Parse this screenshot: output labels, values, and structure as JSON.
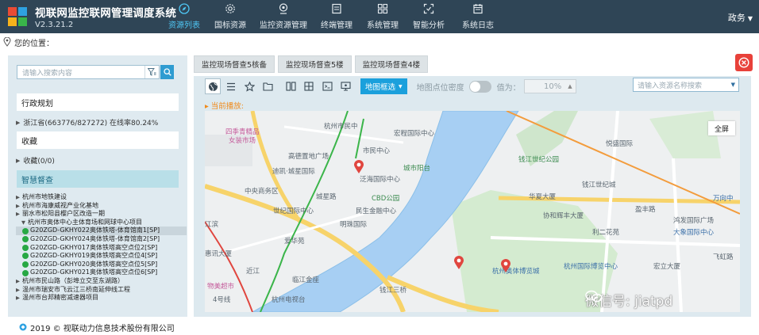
{
  "app": {
    "title": "视联网监控联网管理调度系统",
    "version": "V2.3.21.2",
    "brand_colors": [
      "#e94b35",
      "#2ea1e1",
      "#f6b21b",
      "#39b54a"
    ],
    "user": "政务"
  },
  "nav": [
    {
      "label": "资源列表",
      "icon": "compass-icon",
      "active": true
    },
    {
      "label": "国标资源",
      "icon": "gear-icon",
      "active": false
    },
    {
      "label": "监控资源管理",
      "icon": "location-icon",
      "active": false
    },
    {
      "label": "终端管理",
      "icon": "terminal-icon",
      "active": false
    },
    {
      "label": "系统管理",
      "icon": "grid-icon",
      "active": false
    },
    {
      "label": "智能分析",
      "icon": "scan-icon",
      "active": false
    },
    {
      "label": "系统日志",
      "icon": "calendar-icon",
      "active": false
    }
  ],
  "location": {
    "label": "您的位置："
  },
  "sidebar": {
    "search_placeholder": "请输入搜索内容",
    "sections": {
      "admin_region": "行政规划",
      "admin_region_item": "浙江省(663776/827272) 在线率80.24%",
      "favorites": "收藏",
      "favorites_item": "收藏(0/0)",
      "smart_supervision": "智慧督查"
    },
    "tree": [
      {
        "label": "杭州市地铁建设",
        "level": 1,
        "expanded": false
      },
      {
        "label": "杭州市海康威视产业化基地",
        "level": 1,
        "expanded": false
      },
      {
        "label": "丽水市松阳县樱户区改造一期",
        "level": 1,
        "expanded": false
      },
      {
        "label": "杭州市奥体中心主体育场和网球中心项目",
        "level": 2,
        "expanded": true
      },
      {
        "label": "G20ZGD-GKHY022奥体铁塔-体育馆南1[SP]",
        "level": 3,
        "selected": true
      },
      {
        "label": "G20ZGD-GKHY024奥体铁塔-体育馆南2[SP]",
        "level": 3
      },
      {
        "label": "G20ZGD-GKHY017奥体铁塔高空点位2[SP]",
        "level": 3
      },
      {
        "label": "G20ZGD-GKHY019奥体铁塔高空点位4[SP]",
        "level": 3
      },
      {
        "label": "G20ZGD-GKHY020奥体铁塔高空点位5[SP]",
        "level": 3
      },
      {
        "label": "G20ZGD-GKHY021奥体铁塔高空点位6[SP]",
        "level": 3
      },
      {
        "label": "杭州市民山路（彭埠立交至东湖路）",
        "level": 1,
        "expanded": false
      },
      {
        "label": "温州市瑞安市飞云江三桥南延伸线工程",
        "level": 1,
        "expanded": false
      },
      {
        "label": "温州市台邦精密减速器项目",
        "level": 1,
        "expanded": false
      }
    ]
  },
  "main": {
    "tabs": [
      "监控现场督查5核备",
      "监控现场督查5楼",
      "监控现场督查4楼"
    ],
    "toolbar": {
      "map_select": "地图框选",
      "density_label": "地图点位密度",
      "value_label": "值为：",
      "value": "10%",
      "resource_placeholder": "请输入资源名称搜索"
    },
    "current_play": "当前播放:",
    "map": {
      "fullscreen": "全屏",
      "labels": [
        "四季青精品",
        "女装市场",
        "杭州市民中",
        "市民中心",
        "宏程国际中心",
        "高德置地广场",
        "迪凯·城星国际",
        "城市阳台",
        "钱江世纪公园",
        "悦盛国际",
        "钱江世纪城",
        "中央商务区",
        "城星路",
        "泛海国际中心",
        "CBD公园",
        "世纪国际中心",
        "民生金融中心",
        "明珠国际",
        "华夏大厦",
        "协和辉丰大厦",
        "盈丰路",
        "鸿发国际广场",
        "大象国际中心",
        "利二花苑",
        "万向中",
        "爱华苑",
        "惠讯大厦",
        "江滨",
        "临江金座",
        "钱江三桥",
        "物美超市",
        "杭州电视台",
        "杭州奥体博览城",
        "杭州国际博览中心",
        "宏立大厦",
        "飞虹路",
        "近江",
        "4号线"
      ]
    },
    "watermark": "微信号: jiatpd"
  },
  "footer": {
    "copyright": "2019 © 视联动力信息技术股份有限公司"
  }
}
